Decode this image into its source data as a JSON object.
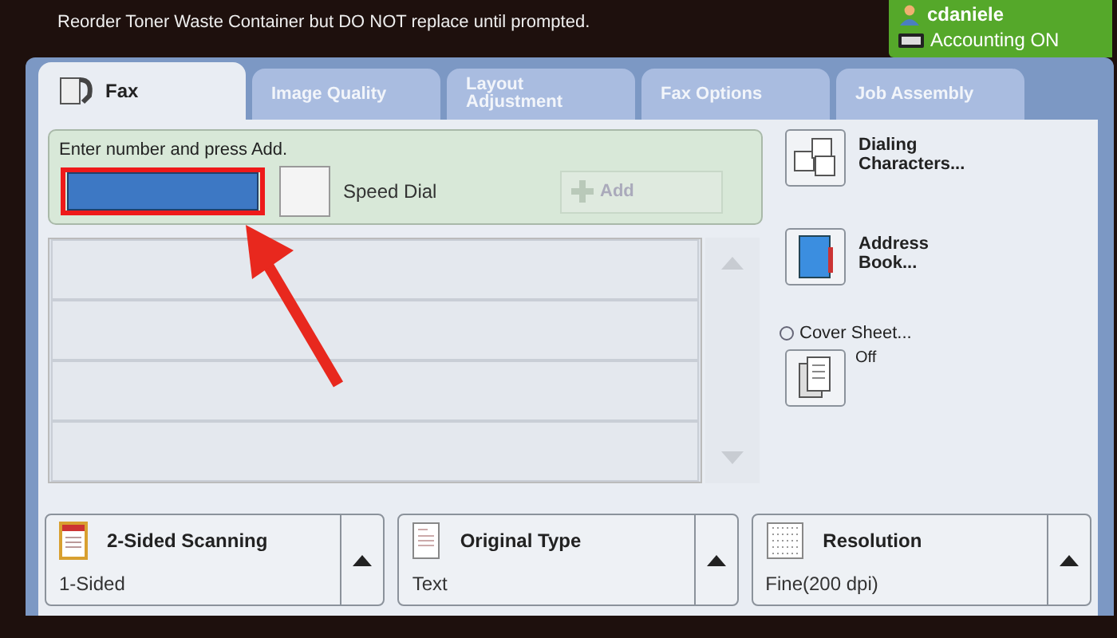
{
  "status_message": "Reorder Toner Waste Container but DO NOT replace until prompted.",
  "user": {
    "name": "cdaniele",
    "accounting": "Accounting ON"
  },
  "tabs": [
    {
      "label": "Fax",
      "selected": true
    },
    {
      "label": "Image Quality",
      "selected": false
    },
    {
      "label": "Layout Adjustment",
      "selected": false
    },
    {
      "label": "Fax Options",
      "selected": false
    },
    {
      "label": "Job Assembly",
      "selected": false
    }
  ],
  "entry": {
    "label": "Enter number and press Add.",
    "highlighted": true,
    "speed_dial": {
      "label": "Speed Dial",
      "checked": false
    },
    "add_button": {
      "label": "Add",
      "disabled": true
    }
  },
  "side_buttons": [
    {
      "kind": "dialing",
      "label": "Dialing Characters..."
    },
    {
      "kind": "address",
      "label": "Address Book..."
    }
  ],
  "cover_sheet": {
    "label": "Cover Sheet...",
    "value": "Off"
  },
  "features": [
    {
      "kind": "sided",
      "title": "2-Sided Scanning",
      "value": "1-Sided"
    },
    {
      "kind": "original",
      "title": "Original Type",
      "value": "Text"
    },
    {
      "kind": "resolution",
      "title": "Resolution",
      "value": "Fine(200 dpi)"
    }
  ]
}
